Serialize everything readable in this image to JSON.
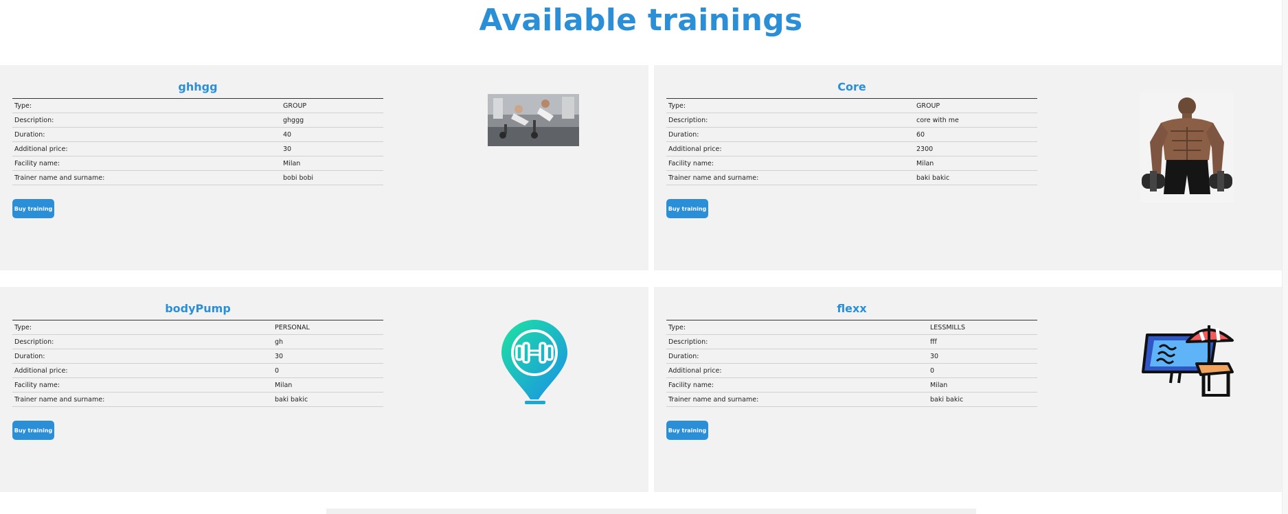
{
  "page": {
    "title": "Available trainings"
  },
  "labels": {
    "type": "Type:",
    "description": "Description:",
    "duration": "Duration:",
    "additional_price": "Additional price:",
    "facility": "Facility name:",
    "trainer": "Trainer name and surname:",
    "buy_button": "Buy training"
  },
  "trainings": [
    {
      "name": "ghhgg",
      "type": "GROUP",
      "description": "ghggg",
      "duration": "40",
      "additional_price": "30",
      "facility": "Milan",
      "trainer": "bobi bobi",
      "image_icon": "people-training-photo"
    },
    {
      "name": "Core",
      "type": "GROUP",
      "description": "core with me",
      "duration": "60",
      "additional_price": "2300",
      "facility": "Milan",
      "trainer": "baki bakic",
      "image_icon": "bodybuilder-photo"
    },
    {
      "name": "bodyPump",
      "type": "PERSONAL",
      "description": "gh",
      "duration": "30",
      "additional_price": "0",
      "facility": "Milan",
      "trainer": "baki bakic",
      "image_icon": "dumbbell-pin-icon"
    },
    {
      "name": "flexx",
      "type": "LESSMILLS",
      "description": "fff",
      "duration": "30",
      "additional_price": "0",
      "facility": "Milan",
      "trainer": "baki bakic",
      "image_icon": "pool-umbrella-icon"
    }
  ],
  "colors": {
    "accent": "#2b8fd8",
    "card_bg": "#f2f2f2"
  }
}
